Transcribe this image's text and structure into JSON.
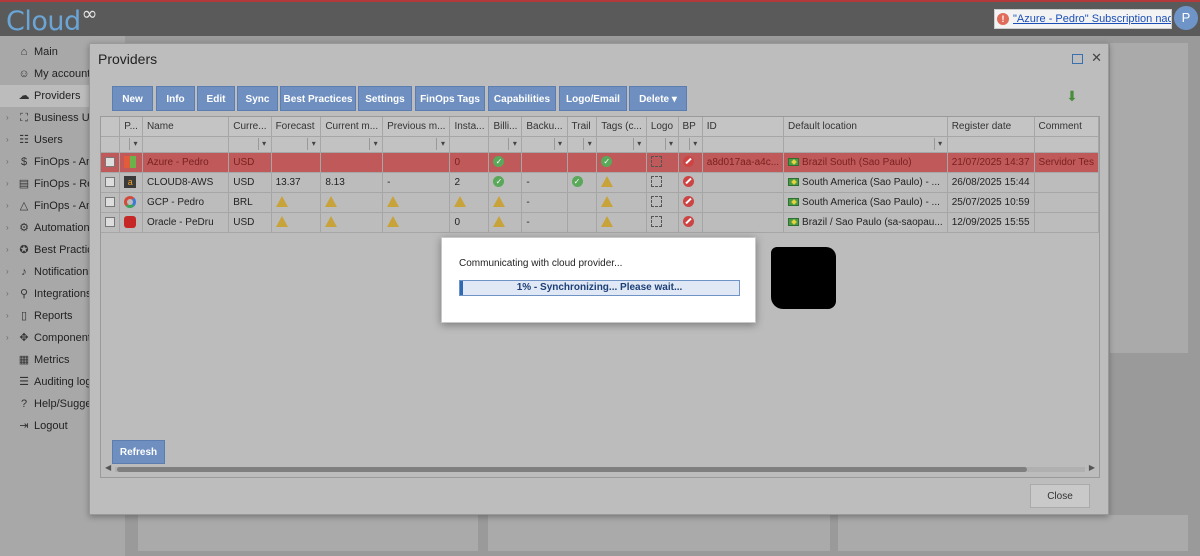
{
  "app": {
    "logo_text": "Cloud",
    "logo_symbol": "∞",
    "notification_text": "\"Azure - Pedro\" Subscription nao ativo",
    "avatar_initial": "P"
  },
  "sidebar": {
    "items": [
      {
        "label": "Main",
        "icon": "home-icon"
      },
      {
        "label": "My account",
        "icon": "user-icon"
      },
      {
        "label": "Providers",
        "icon": "cloud-icon"
      },
      {
        "label": "Business Unit",
        "icon": "hierarchy-icon"
      },
      {
        "label": "Users",
        "icon": "users-icon"
      },
      {
        "label": "FinOps - Ana",
        "icon": "dollar-icon"
      },
      {
        "label": "FinOps - Rep",
        "icon": "report-icon"
      },
      {
        "label": "FinOps - Ano",
        "icon": "warning-icon"
      },
      {
        "label": "Automations",
        "icon": "gear-icon"
      },
      {
        "label": "Best Practices",
        "icon": "seal-icon"
      },
      {
        "label": "Notifications",
        "icon": "bell-icon"
      },
      {
        "label": "Integrations",
        "icon": "plug-icon"
      },
      {
        "label": "Reports",
        "icon": "document-icon"
      },
      {
        "label": "Components",
        "icon": "components-icon"
      },
      {
        "label": "Metrics",
        "icon": "metrics-icon"
      },
      {
        "label": "Auditing logs",
        "icon": "list-icon"
      },
      {
        "label": "Help/Sugges",
        "icon": "help-icon"
      },
      {
        "label": "Logout",
        "icon": "logout-icon"
      }
    ]
  },
  "dialog": {
    "title": "Providers",
    "toolbar": [
      "New",
      "Info",
      "Edit",
      "Sync",
      "Best Practices",
      "Settings",
      "FinOps Tags",
      "Capabilities",
      "Logo/Email",
      "Delete"
    ],
    "refresh_label": "Refresh",
    "close_label": "Close"
  },
  "grid": {
    "columns": [
      "P...",
      "Name",
      "Curre...",
      "Forecast",
      "Current m...",
      "Previous m...",
      "Insta...",
      "Billi...",
      "Backu...",
      "Trail",
      "Tags (c...",
      "Logo",
      "BP",
      "ID",
      "Default location",
      "Register date",
      "Comment"
    ],
    "rows": [
      {
        "name": "Azure - Pedro",
        "currency": "USD",
        "forecast": "",
        "current": "",
        "previous": "",
        "instances": "0",
        "billing": "ok",
        "backup": "",
        "trail": "",
        "tags": "ok",
        "bp": "no",
        "id": "a8d017aa-a4c...",
        "location": "Brazil South (Sao Paulo)",
        "register": "21/07/2025 14:37",
        "comment": "Servidor Tes",
        "logo": "azure"
      },
      {
        "name": "CLOUD8-AWS",
        "currency": "USD",
        "forecast": "13.37",
        "current": "8.13",
        "previous": "-",
        "instances": "2",
        "billing": "ok",
        "backup": "-",
        "trail": "ok",
        "tags": "warn",
        "bp": "no",
        "id": "",
        "location": "South America (Sao Paulo) - ...",
        "register": "26/08/2025 15:44",
        "comment": "",
        "logo": "aws"
      },
      {
        "name": "GCP - Pedro",
        "currency": "BRL",
        "forecast": "warn",
        "current": "warn",
        "previous": "warn",
        "instances": "warn",
        "billing": "warn",
        "backup": "-",
        "trail": "",
        "tags": "warn",
        "bp": "no",
        "id": "",
        "location": "South America (Sao Paulo) - ...",
        "register": "25/07/2025 10:59",
        "comment": "",
        "logo": "gcp"
      },
      {
        "name": "Oracle - PeDru",
        "currency": "USD",
        "forecast": "warn",
        "current": "warn",
        "previous": "warn",
        "instances": "0",
        "billing": "warn",
        "backup": "-",
        "trail": "",
        "tags": "warn",
        "bp": "no",
        "id": "",
        "location": "Brazil / Sao Paulo (sa-saopau...",
        "register": "12/09/2025 15:55",
        "comment": "",
        "logo": "oracle"
      }
    ]
  },
  "progress": {
    "message": "Communicating with cloud provider...",
    "text": "1% - Synchronizing... Please wait...",
    "percent": 1
  },
  "colors": {
    "button": "#6e8fc0",
    "selected_row": "#c05a5a",
    "ok": "#5aa85a",
    "warn": "#c7a33a",
    "no": "#cc4444",
    "progress": "#2f69b6"
  }
}
